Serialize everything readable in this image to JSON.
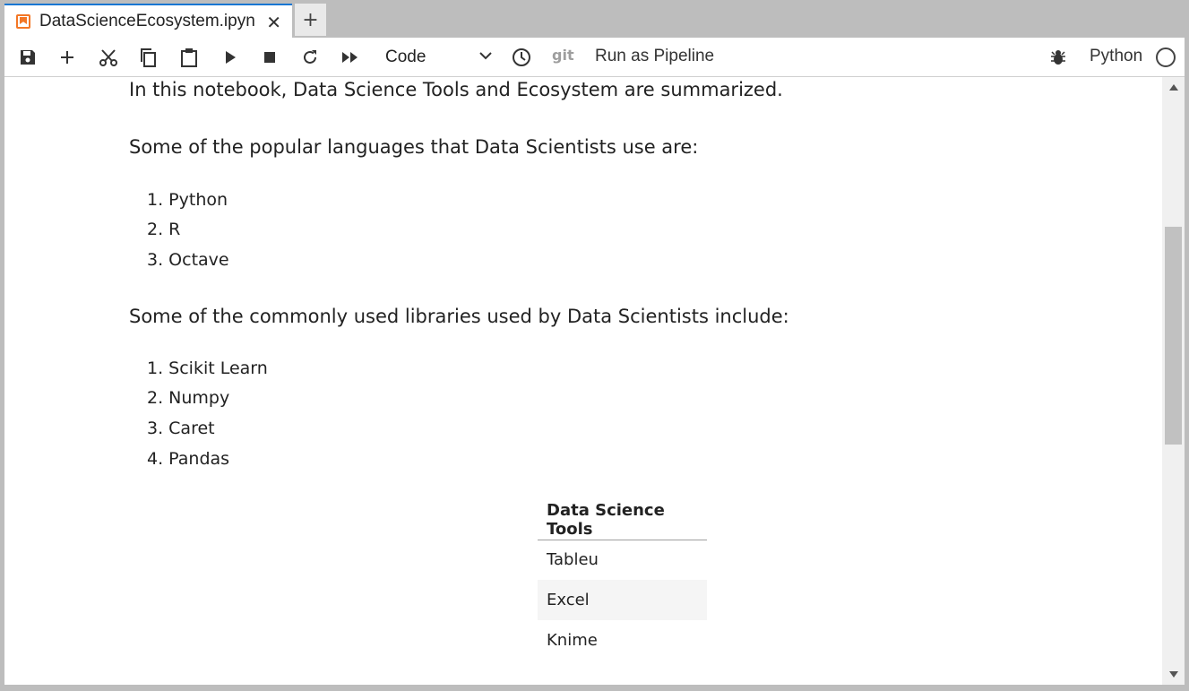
{
  "tab": {
    "title": "DataScienceEcosystem.ipyn",
    "close_glyph": "✕",
    "add_glyph": "+"
  },
  "toolbar": {
    "cell_type": "Code",
    "git_label": "git",
    "pipeline_label": "Run as Pipeline",
    "kernel_name": "Python",
    "icons": [
      "save-icon",
      "add-cell-icon",
      "cut-icon",
      "copy-icon",
      "paste-icon",
      "run-icon",
      "stop-icon",
      "restart-icon",
      "run-all-icon",
      "history-icon",
      "bug-icon"
    ]
  },
  "notebook": {
    "intro": "In this notebook, Data Science Tools and Ecosystem are summarized.",
    "languages_heading": "Some of the popular languages that Data Scientists use are:",
    "languages": [
      "1. Python",
      "2. R",
      "3. Octave"
    ],
    "libraries_heading": "Some of the commonly used libraries used by Data Scientists include:",
    "libraries": [
      "1. Scikit Learn",
      "2. Numpy",
      "3. Caret",
      "4. Pandas"
    ],
    "tools_table": {
      "header": "Data Science Tools",
      "rows": [
        "Tableu",
        "Excel",
        "Knime"
      ]
    }
  },
  "colors": {
    "accent": "#1976d2",
    "notebook_icon": "#f37726",
    "chrome_bg": "#bdbdbd"
  }
}
